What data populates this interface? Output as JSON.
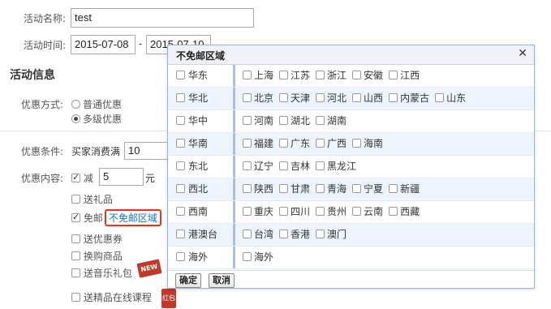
{
  "form": {
    "name_label": "活动名称:",
    "name_value": "test",
    "time_label": "活动时间:",
    "start_date": "2015-07-08",
    "date_sep": "-",
    "end_date": "2015-07-10",
    "section_title": "活动信息",
    "discount_mode_label": "优惠方式:",
    "mode_options": [
      "普通优惠",
      "多级优惠"
    ],
    "mode_selected": "多级优惠",
    "condition_label": "优惠条件:",
    "condition_text": "买家消费满",
    "condition_value": "10",
    "content_label": "优惠内容:",
    "reduce_label": "减",
    "reduce_value": "5",
    "reduce_unit": "元",
    "gift_label": "送礼品",
    "free_ship_label": "免邮",
    "free_ship_link": "不免邮区域",
    "coupon_label": "送优惠券",
    "exchange_label": "换购商品",
    "music_label": "送音乐礼包",
    "course_label": "送精品在线课程",
    "badge_new": "NEW",
    "badge_hb": "红包"
  },
  "dialog": {
    "title": "不免邮区域",
    "close_icon": "close-icon",
    "confirm": "确定",
    "cancel": "取消",
    "regions": [
      {
        "name": "华东",
        "provinces": [
          "上海",
          "江苏",
          "浙江",
          "安徽",
          "江西"
        ]
      },
      {
        "name": "华北",
        "provinces": [
          "北京",
          "天津",
          "河北",
          "山西",
          "内蒙古",
          "山东"
        ]
      },
      {
        "name": "华中",
        "provinces": [
          "河南",
          "湖北",
          "湖南"
        ]
      },
      {
        "name": "华南",
        "provinces": [
          "福建",
          "广东",
          "广西",
          "海南"
        ]
      },
      {
        "name": "东北",
        "provinces": [
          "辽宁",
          "吉林",
          "黑龙江"
        ]
      },
      {
        "name": "西北",
        "provinces": [
          "陕西",
          "甘肃",
          "青海",
          "宁夏",
          "新疆"
        ]
      },
      {
        "name": "西南",
        "provinces": [
          "重庆",
          "四川",
          "贵州",
          "云南",
          "西藏"
        ]
      },
      {
        "name": "港澳台",
        "provinces": [
          "台湾",
          "香港",
          "澳门"
        ]
      },
      {
        "name": "海外",
        "provinces": [
          "海外"
        ]
      }
    ]
  }
}
